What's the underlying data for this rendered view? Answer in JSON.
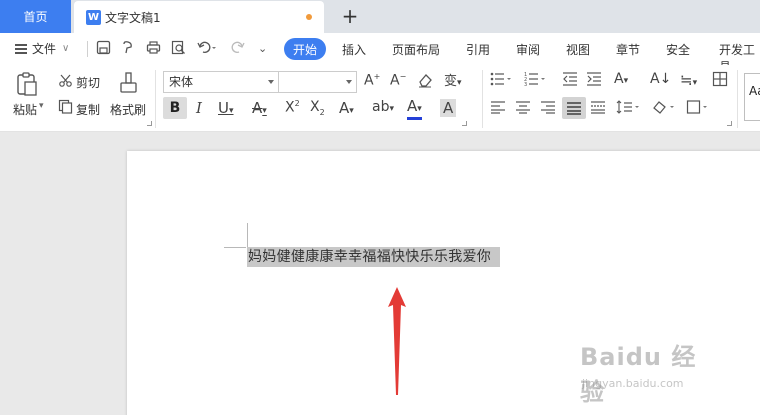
{
  "tabs": {
    "home": "首页",
    "doc_icon": "W",
    "document": "文字文稿1",
    "add": "+"
  },
  "menu": {
    "file": "文件",
    "items": [
      "插入",
      "页面布局",
      "引用",
      "审阅",
      "视图",
      "章节",
      "安全",
      "开发工具"
    ],
    "active": "开始"
  },
  "ribbon": {
    "paste": "粘贴",
    "cut": "剪切",
    "copy": "复制",
    "format_painter": "格式刷",
    "font_name": "宋体",
    "font_size": "",
    "style_preview": "Aa"
  },
  "document": {
    "text": "妈妈健健康康幸幸福福快快乐乐我爱你"
  },
  "watermark": {
    "brand": "Baidu 经验",
    "url": "jingyan.baidu.com"
  },
  "colors": {
    "accent": "#3d7ef0",
    "arrow": "#e33b36",
    "selection": "#c8c8c8"
  }
}
